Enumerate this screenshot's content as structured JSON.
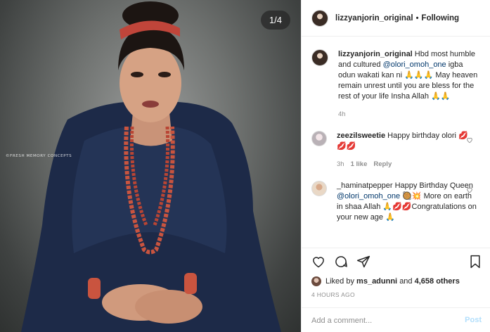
{
  "photo": {
    "counter": "1/4",
    "watermark": "©FRESH MEMORY CONCEPTS"
  },
  "header": {
    "username": "lizzyanjorin_original",
    "separator": "•",
    "follow_status": "Following"
  },
  "caption": {
    "username": "lizzyanjorin_original",
    "text_before": " Hbd most humble and cultured ",
    "mention": "@olori_omoh_one",
    "text_after": " igba odun wakati kan ni 🙏🙏🙏 May heaven remain unrest until you are bless for the rest of your life Insha Allah 🙏🙏",
    "time": "4h"
  },
  "comments": [
    {
      "username": "zeezilsweetie",
      "text": " Happy birthday olori 💋💋💋",
      "time": "3h",
      "likes": "1 like",
      "reply": "Reply"
    },
    {
      "username": "_haminatpepper",
      "text_before": " Happy Birthday Queen ",
      "mention": "@olori_omoh_one",
      "text_after": " 🥘💥 More on earth in shaa Allah 🙏💋💋Congratulations on your new age 🙏"
    }
  ],
  "footer": {
    "liked_by_prefix": "Liked by ",
    "liked_by_user": "ms_adunni",
    "liked_by_mid": " and ",
    "liked_by_count": "4,658 others",
    "timestamp": "4 HOURS AGO",
    "comment_placeholder": "Add a comment...",
    "post_label": "Post"
  },
  "icons": [
    "heart-icon",
    "comment-icon",
    "share-icon",
    "bookmark-icon",
    "small-heart-icon"
  ]
}
